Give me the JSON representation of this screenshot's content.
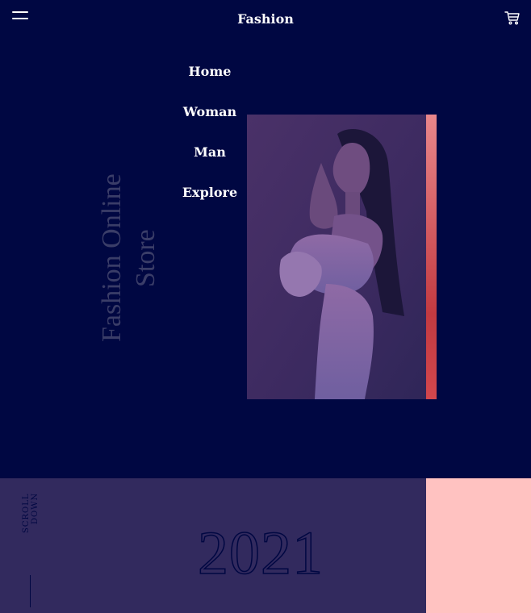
{
  "header": {
    "brand": "Fashion",
    "menu_icon": "hamburger-menu-icon",
    "cart_icon": "shopping-cart-icon"
  },
  "nav": {
    "items": [
      {
        "label": "Home"
      },
      {
        "label": "Woman"
      },
      {
        "label": "Man"
      },
      {
        "label": "Explore"
      }
    ]
  },
  "hero": {
    "title": "Fashion Online Store",
    "image_alt": "woman in pink ruffled off-shoulder dress",
    "accent_color": "#d2474d"
  },
  "footer": {
    "scroll_label": "SCROLL DOWN",
    "year": "2021"
  },
  "colors": {
    "background": "#000742",
    "panel": "#322a5e",
    "pink": "#ffc2c1",
    "muted_title": "#3a3d68"
  }
}
